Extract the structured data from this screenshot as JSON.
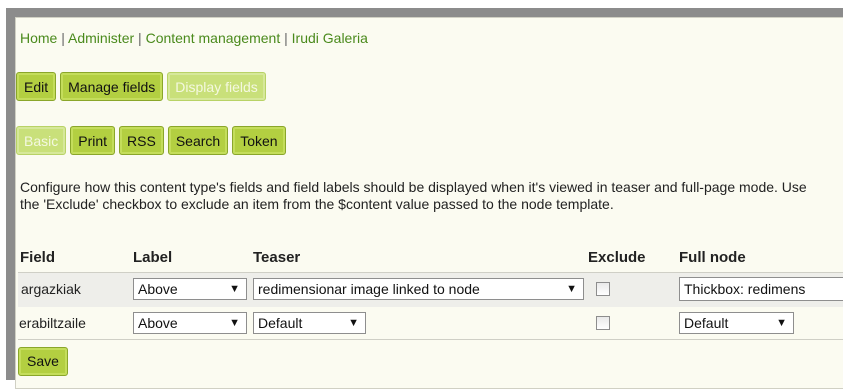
{
  "breadcrumb": {
    "items": [
      "Home",
      "Administer",
      "Content management",
      "Irudi Galeria"
    ],
    "separator": "|"
  },
  "primary_tabs": [
    {
      "label": "Edit",
      "active": false
    },
    {
      "label": "Manage fields",
      "active": false
    },
    {
      "label": "Display fields",
      "active": true
    }
  ],
  "secondary_tabs": [
    {
      "label": "Basic",
      "active": true
    },
    {
      "label": "Print",
      "active": false
    },
    {
      "label": "RSS",
      "active": false
    },
    {
      "label": "Search",
      "active": false
    },
    {
      "label": "Token",
      "active": false
    }
  ],
  "description": "Configure how this content type's fields and field labels should be displayed when it's viewed in teaser and full-page mode. Use the 'Exclude' checkbox to exclude an item from the $content value passed to the node template.",
  "table": {
    "headers": {
      "field": "Field",
      "label": "Label",
      "teaser": "Teaser",
      "exclude": "Exclude",
      "full_node": "Full node"
    },
    "rows": [
      {
        "field": "argazkiak",
        "label": "Above",
        "teaser": "redimensionar image linked to node",
        "exclude": false,
        "full_node": "Thickbox: redimens"
      },
      {
        "field": "erabiltzaile",
        "label": "Above",
        "teaser": "Default",
        "exclude": false,
        "full_node": "Default"
      }
    ]
  },
  "save_label": "Save",
  "icons": {
    "dropdown": "chevron-down-icon"
  },
  "colors": {
    "tab_bg": "#b3cf41",
    "tab_active_bg": "#c9e07a",
    "link": "#4a8a1c",
    "frame_bg": "#fbfbf1"
  }
}
